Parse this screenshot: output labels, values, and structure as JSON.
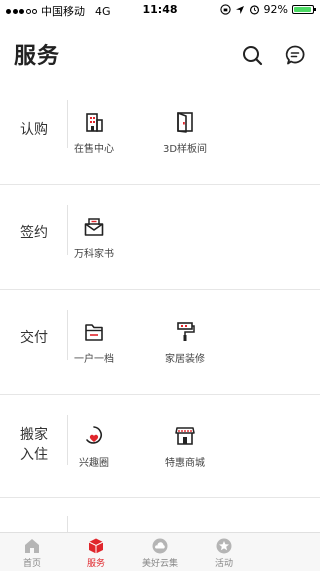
{
  "status_bar": {
    "carrier": "中国移动",
    "network": "4G",
    "time": "11:48",
    "battery_text": "92%",
    "battery_level": 0.92
  },
  "header": {
    "title": "服务",
    "icons": [
      "search-icon",
      "message-icon"
    ]
  },
  "sections": [
    {
      "label": "认购",
      "items": [
        {
          "label": "在售中心",
          "icon": "building-icon"
        },
        {
          "label": "3D样板间",
          "icon": "door-icon"
        }
      ]
    },
    {
      "label": "签约",
      "items": [
        {
          "label": "万科家书",
          "icon": "envelope-icon"
        }
      ]
    },
    {
      "label": "交付",
      "items": [
        {
          "label": "一户一档",
          "icon": "folder-icon"
        },
        {
          "label": "家居装修",
          "icon": "paint-roller-icon"
        }
      ]
    },
    {
      "label_line1": "搬家",
      "label_line2": "入住",
      "items": [
        {
          "label": "兴趣圈",
          "icon": "heart-pin-icon"
        },
        {
          "label": "特惠商城",
          "icon": "shop-icon"
        }
      ]
    }
  ],
  "tab_bar": {
    "active_color": "#e0262c",
    "inactive_color": "#b5b5b5",
    "tabs": [
      {
        "label": "首页",
        "icon": "home-icon",
        "active": false
      },
      {
        "label": "服务",
        "icon": "cube-icon",
        "active": true
      },
      {
        "label": "美好云集",
        "icon": "cloud-icon",
        "active": false
      },
      {
        "label": "活动",
        "icon": "star-icon",
        "active": false
      }
    ]
  }
}
